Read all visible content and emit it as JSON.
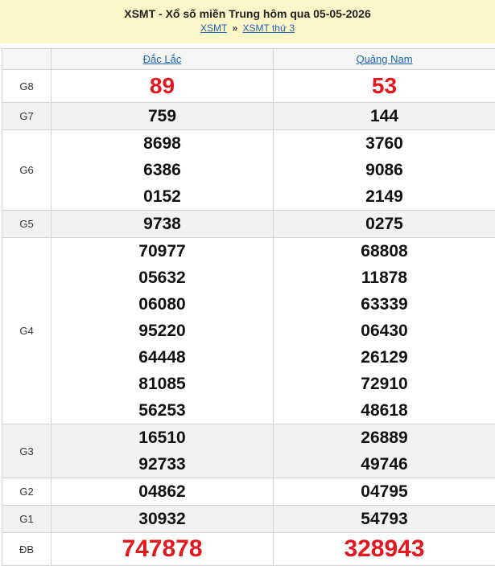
{
  "header": {
    "title": "XSMT - Xổ số miền Trung hôm qua 05-05-2026",
    "crumb1": "XSMT",
    "separator": "»",
    "crumb2": "XSMT thứ 3"
  },
  "provinces": [
    "Đắc Lắc",
    "Quảng Nam"
  ],
  "prizes": [
    {
      "label": "G8",
      "cols": [
        [
          "89"
        ],
        [
          "53"
        ]
      ],
      "highlight": true
    },
    {
      "label": "G7",
      "cols": [
        [
          "759"
        ],
        [
          "144"
        ]
      ]
    },
    {
      "label": "G6",
      "cols": [
        [
          "8698",
          "6386",
          "0152"
        ],
        [
          "3760",
          "9086",
          "2149"
        ]
      ]
    },
    {
      "label": "G5",
      "cols": [
        [
          "9738"
        ],
        [
          "0275"
        ]
      ]
    },
    {
      "label": "G4",
      "cols": [
        [
          "70977",
          "05632",
          "06080",
          "95220",
          "64448",
          "81085",
          "56253"
        ],
        [
          "68808",
          "11878",
          "63339",
          "06430",
          "26129",
          "72910",
          "48618"
        ]
      ]
    },
    {
      "label": "G3",
      "cols": [
        [
          "16510",
          "92733"
        ],
        [
          "26889",
          "49746"
        ]
      ]
    },
    {
      "label": "G2",
      "cols": [
        [
          "04862"
        ],
        [
          "04795"
        ]
      ]
    },
    {
      "label": "G1",
      "cols": [
        [
          "30932"
        ],
        [
          "54793"
        ]
      ]
    },
    {
      "label": "ĐB",
      "cols": [
        [
          "747878"
        ],
        [
          "328943"
        ]
      ],
      "highlight": true
    }
  ],
  "colors": {
    "highlight": "#e3181e",
    "link": "#1a64b4",
    "header_bg": "#fdf6c8",
    "shade": "#f2f2f2"
  }
}
